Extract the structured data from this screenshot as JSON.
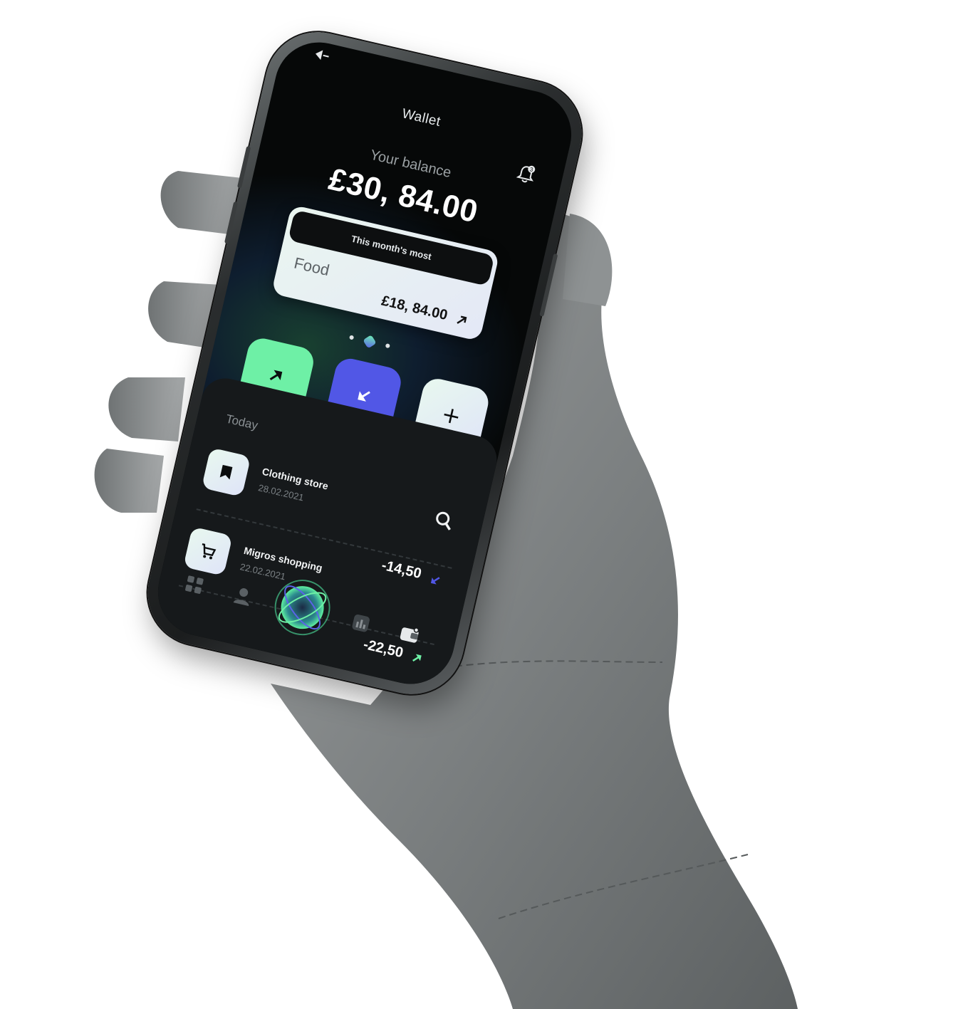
{
  "header": {
    "title": "Wallet",
    "notification_count": "3"
  },
  "balance": {
    "label": "Your balance",
    "amount": "£30, 84.00"
  },
  "summary_card": {
    "heading": "This month's most",
    "category": "Food",
    "amount": "£18, 84.00"
  },
  "carousel": {
    "pages": 3,
    "active": 2
  },
  "actions": [
    {
      "name": "send",
      "icon": "arrow-up-right-icon",
      "color": "#6ef0a6"
    },
    {
      "name": "request",
      "icon": "arrow-down-left-icon",
      "color": "#5157e6"
    },
    {
      "name": "add",
      "icon": "plus-icon"
    }
  ],
  "transactions": {
    "section_label": "Today",
    "items": [
      {
        "name": "Clothing store",
        "date": "28.02.2021",
        "amount": "-14,50",
        "icon": "bookmark-icon",
        "badge": "arrow-down-left-icon",
        "badge_color": "#5157e6"
      },
      {
        "name": "Migros shopping",
        "date": "22.02.2021",
        "amount": "-22,50",
        "icon": "cart-icon",
        "badge": "arrow-up-right-icon",
        "badge_color": "#6ef0a6"
      }
    ]
  },
  "nav": {
    "items": [
      "grid-icon",
      "user-icon",
      "orb-icon",
      "chart-icon",
      "wallet-icon"
    ],
    "active": "orb-icon"
  },
  "colors": {
    "accent_green": "#6ef0a6",
    "accent_blue": "#5157e6",
    "screen_bg": "#060808",
    "sheet_bg": "#16191b"
  }
}
